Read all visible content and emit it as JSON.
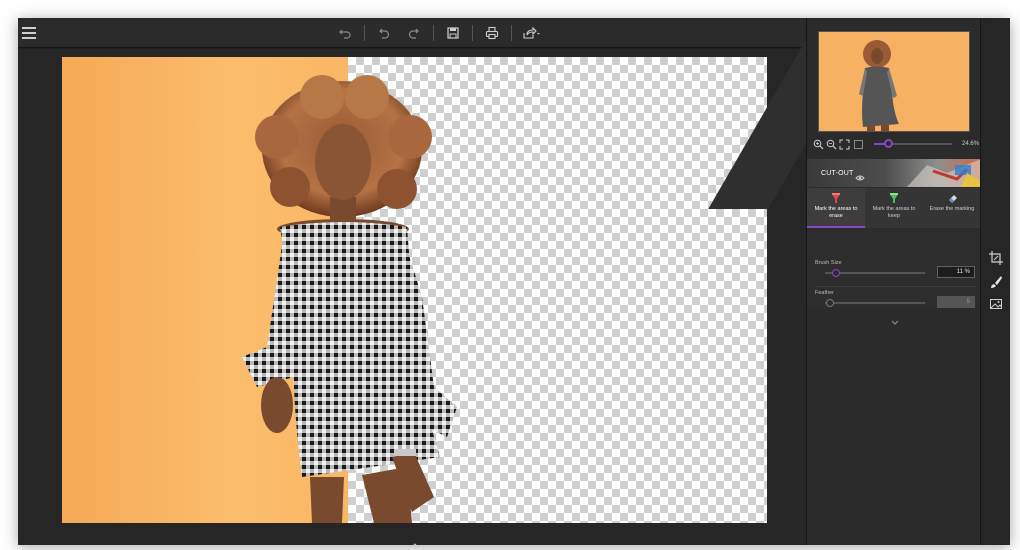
{
  "toolbar": {
    "menu_icon": "hamburger-menu-icon",
    "buttons": [
      {
        "name": "undo",
        "icon": "undo-icon"
      },
      {
        "name": "undo-step",
        "icon": "undo-step-icon"
      },
      {
        "name": "redo",
        "icon": "redo-icon"
      },
      {
        "name": "save",
        "icon": "save-icon"
      },
      {
        "name": "print",
        "icon": "print-icon"
      },
      {
        "name": "share",
        "icon": "share-icon"
      }
    ]
  },
  "navigator": {
    "zoom_value": "24.6%",
    "zoom_fraction": 0.18
  },
  "cutout": {
    "label": "CUT-OUT",
    "modes": [
      {
        "label": "Mark the areas to erase",
        "icon": "red-erase-marker-icon",
        "active": true
      },
      {
        "label": "Mark the areas to keep",
        "icon": "green-keep-marker-icon",
        "active": false
      },
      {
        "label": "Erase the marking",
        "icon": "eraser-icon",
        "active": false
      }
    ],
    "brush_size": {
      "label": "Brush Size",
      "value": "11 %",
      "fraction": 0.11
    },
    "feather": {
      "label": "Feather",
      "value": "5",
      "fraction": 0.05
    }
  },
  "tools": [
    {
      "name": "crop",
      "icon": "crop-icon"
    },
    {
      "name": "brush",
      "icon": "brush-icon"
    },
    {
      "name": "image-adjust",
      "icon": "image-icon"
    }
  ],
  "colors": {
    "accent": "#8a46c9",
    "background": "#1f1f1f",
    "panel": "#2b2b2b",
    "backdrop_orange": "#f9b765"
  }
}
